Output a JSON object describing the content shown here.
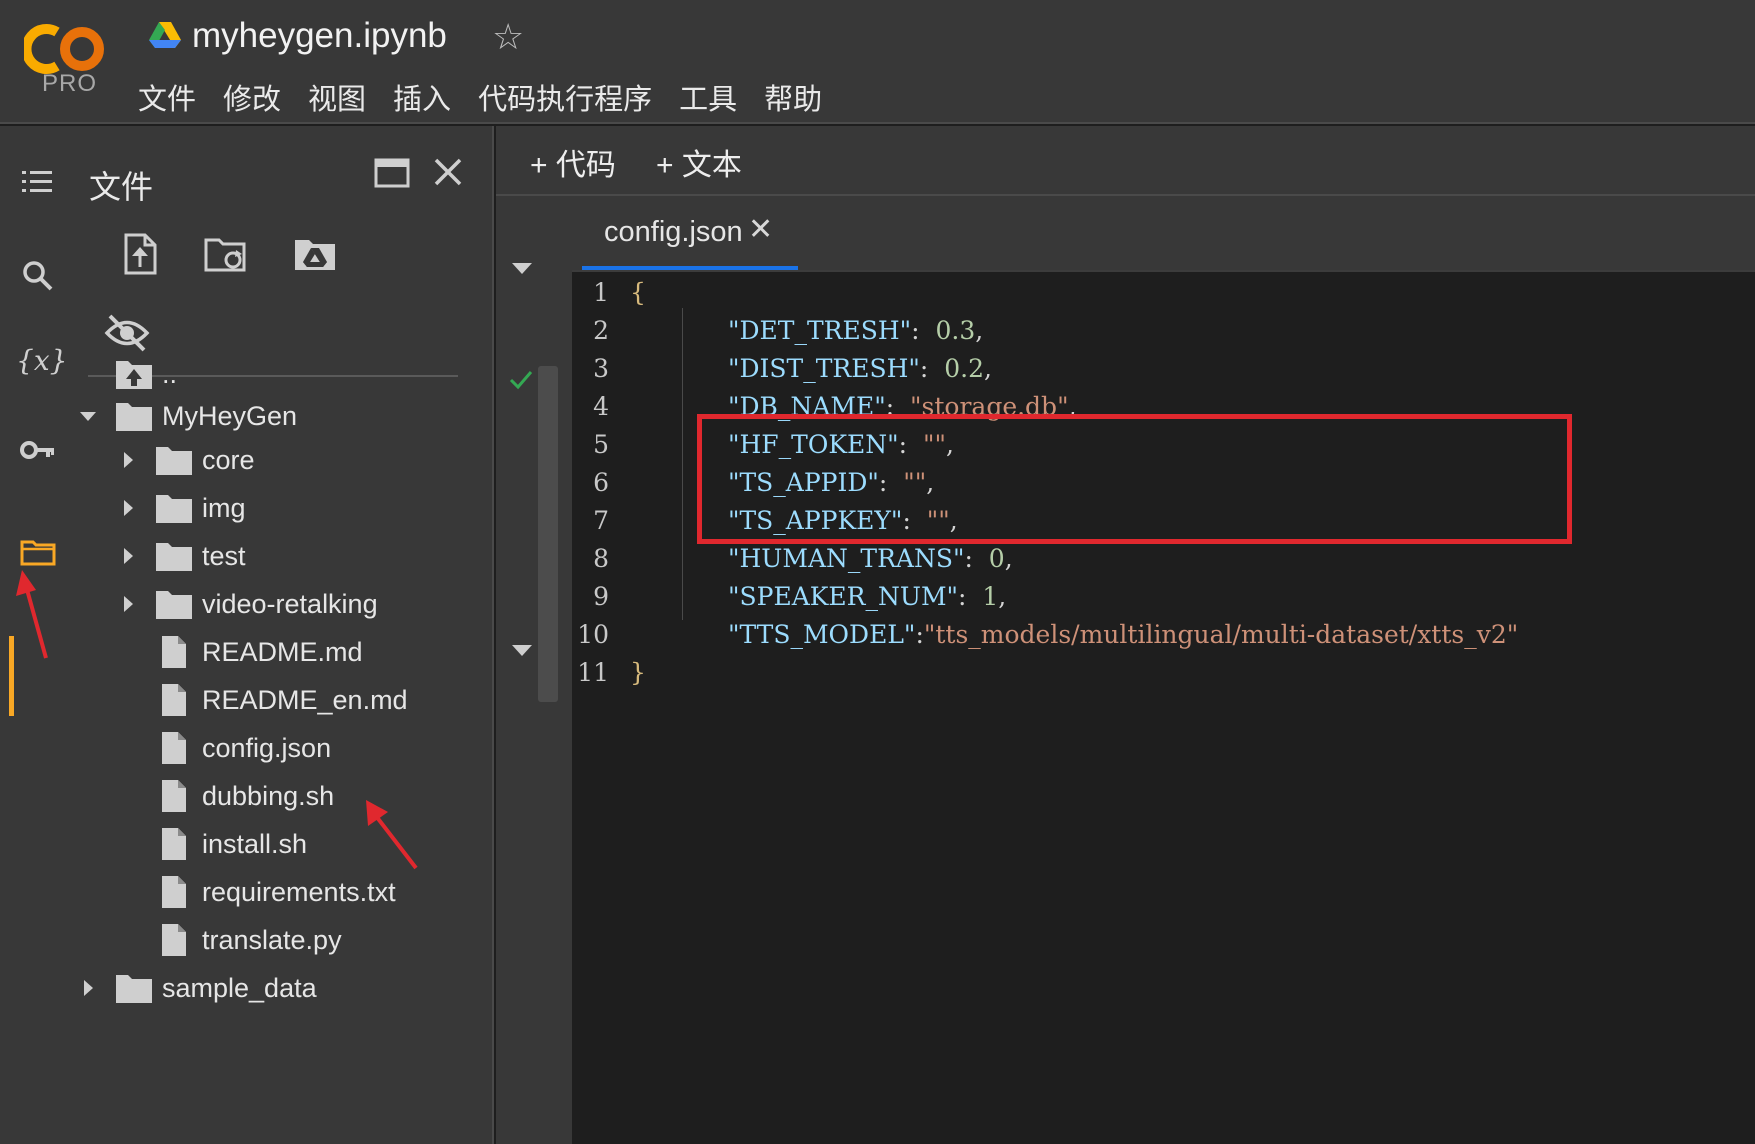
{
  "header": {
    "logo_text": "CO",
    "pro_label": "PRO",
    "notebook_title": "myheygen.ipynb",
    "menu": [
      "文件",
      "修改",
      "视图",
      "插入",
      "代码执行程序",
      "工具",
      "帮助"
    ]
  },
  "sidebar": {
    "title": "文件"
  },
  "file_tree": {
    "parent": "..",
    "root_folder": "MyHeyGen",
    "subfolders": [
      "core",
      "img",
      "test",
      "video-retalking"
    ],
    "files": [
      "README.md",
      "README_en.md",
      "config.json",
      "dubbing.sh",
      "install.sh",
      "requirements.txt",
      "translate.py"
    ],
    "other_folder": "sample_data"
  },
  "toolbar": {
    "add_code": "+ 代码",
    "add_text": "+ 文本"
  },
  "editor": {
    "tab_label": "config.json",
    "tab_close": "✕",
    "lines": [
      {
        "n": "1",
        "open": "{"
      },
      {
        "n": "2",
        "key": "\"DET_TRESH\"",
        "sep": ":  ",
        "val": "0.3",
        "vtype": "num",
        "end": ","
      },
      {
        "n": "3",
        "key": "\"DIST_TRESH\"",
        "sep": ":  ",
        "val": "0.2",
        "vtype": "num",
        "end": ","
      },
      {
        "n": "4",
        "key": "\"DB_NAME\"",
        "sep": ":  ",
        "val": "\"storage.db\"",
        "vtype": "str",
        "end": ","
      },
      {
        "n": "5",
        "key": "\"HF_TOKEN\"",
        "sep": ":  ",
        "val": "\"\"",
        "vtype": "str",
        "end": ","
      },
      {
        "n": "6",
        "key": "\"TS_APPID\"",
        "sep": ":  ",
        "val": "\"\"",
        "vtype": "str",
        "end": ","
      },
      {
        "n": "7",
        "key": "\"TS_APPKEY\"",
        "sep": ":  ",
        "val": "\"\"",
        "vtype": "str",
        "end": ","
      },
      {
        "n": "8",
        "key": "\"HUMAN_TRANS\"",
        "sep": ":  ",
        "val": "0",
        "vtype": "num",
        "end": ","
      },
      {
        "n": "9",
        "key": "\"SPEAKER_NUM\"",
        "sep": ":  ",
        "val": "1",
        "vtype": "num",
        "end": ","
      },
      {
        "n": "10",
        "key": "\"TTS_MODEL\"",
        "sep": ":",
        "val": "\"tts_models/multilingual/multi-dataset/xtts_v2\"",
        "vtype": "str",
        "end": ""
      },
      {
        "n": "11",
        "close": "}"
      }
    ]
  },
  "colors": {
    "accent_orange": "#f9a825",
    "tab_underline": "#1a73e8",
    "highlight_red": "#e0282e",
    "check_green": "#34a853"
  }
}
